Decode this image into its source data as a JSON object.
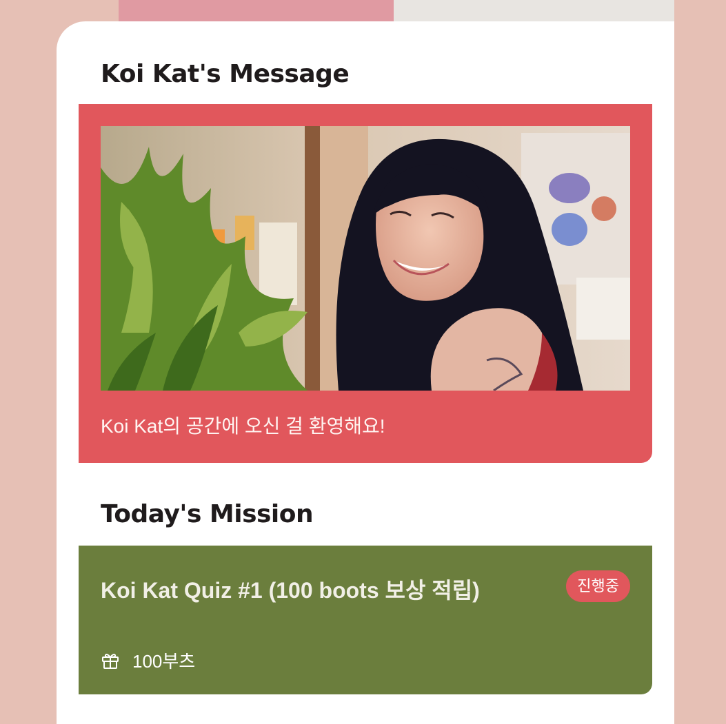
{
  "message_section": {
    "title": "Koi Kat's Message",
    "photo_alt": "Koi Kat",
    "text": "Koi Kat의 공간에 오신 걸 환영해요!"
  },
  "mission_section": {
    "title": "Today's Mission",
    "mission": {
      "name": "Koi Kat Quiz #1 (100 boots 보상 적립)",
      "status": "진행중",
      "reward": "100부츠",
      "reward_icon": "gift-icon"
    }
  },
  "colors": {
    "page_background": "#e6c0b5",
    "card_background": "#ffffff",
    "message_panel": "#e1575c",
    "mission_panel": "#6b7e3d",
    "status_badge": "#e1575c",
    "strip_pink": "#e09aa2",
    "strip_grey": "#e8e5e1"
  }
}
